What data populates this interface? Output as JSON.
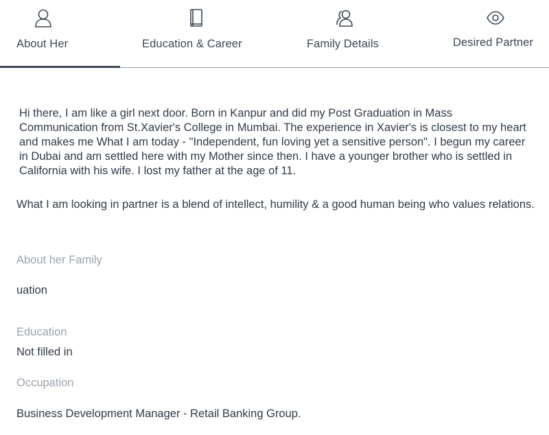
{
  "tabs": [
    {
      "label": "About Her",
      "icon": "user-icon",
      "active": true
    },
    {
      "label": "Education & Career",
      "icon": "book-icon",
      "active": false
    },
    {
      "label": "Family Details",
      "icon": "users-icon",
      "active": false
    },
    {
      "label": "Desired Partner",
      "icon": "eye-icon",
      "active": false
    }
  ],
  "about": {
    "paragraph1": "Hi there, I am like a girl next door. Born in Kanpur and did my Post Graduation in Mass Communication from St.Xavier's College in Mumbai. The experience in Xavier's is closest to my heart and makes me What I am today - \"Independent, fun loving yet a sensitive person\". I begun my career in Dubai and am settled here with my Mother since then. I have a younger brother who is settled in California with his wife. I lost my father at the age of 11.",
    "paragraph2": "What I am looking in partner is a blend of intellect, humility & a good human being who values relations."
  },
  "fields": {
    "family_label": "About her Family",
    "family_value": "uation",
    "education_label": "Education",
    "education_value": "Not filled in",
    "occupation_label": "Occupation",
    "occupation_value": "Business Development Manager - Retail Banking Group."
  },
  "colors": {
    "text": "#2f3a48",
    "muted": "#9ba3ad",
    "active_underline": "#3b4654"
  }
}
